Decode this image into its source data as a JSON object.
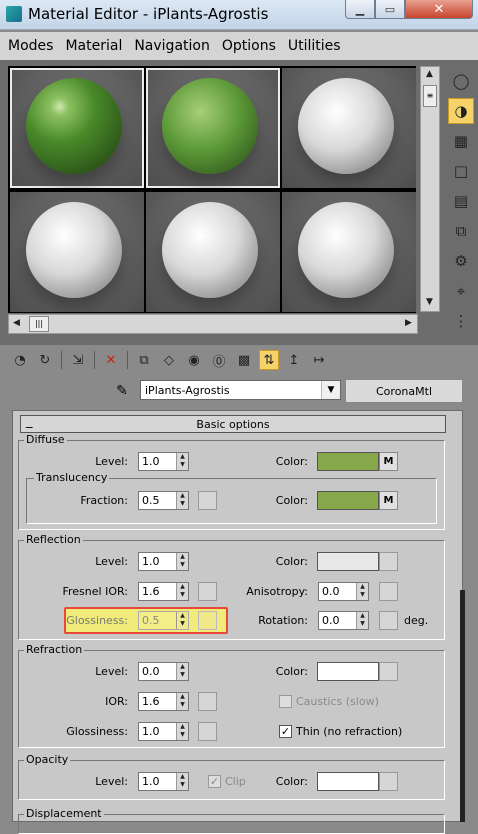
{
  "window": {
    "title": "Material Editor - iPlants-Agrostis",
    "app_icon": "3dsmax-icon"
  },
  "menu": [
    "Modes",
    "Material",
    "Navigation",
    "Options",
    "Utilities"
  ],
  "slots": [
    {
      "id": 1,
      "style": "glossy-green",
      "color": "#4a8a2a"
    },
    {
      "id": 2,
      "style": "matte-green",
      "color": "#5d9a38"
    },
    {
      "id": 3,
      "style": "white",
      "color": "#d8d8d8"
    },
    {
      "id": 4,
      "style": "white",
      "color": "#d8d8d8"
    },
    {
      "id": 5,
      "style": "white",
      "color": "#d8d8d8"
    },
    {
      "id": 6,
      "style": "white",
      "color": "#d8d8d8"
    }
  ],
  "material": {
    "name": "iPlants-Agrostis",
    "type": "CoronaMtl"
  },
  "rollout": {
    "title": "Basic options",
    "collapse": "_"
  },
  "diffuse": {
    "title": "Diffuse",
    "level_label": "Level:",
    "level": "1.0",
    "color_label": "Color:",
    "color": "#86a84a",
    "map": "M",
    "translucency": {
      "title": "Translucency",
      "fraction_label": "Fraction:",
      "fraction": "0.5",
      "color_label": "Color:",
      "color": "#86a84a",
      "map": "M"
    }
  },
  "reflection": {
    "title": "Reflection",
    "level_label": "Level:",
    "level": "1.0",
    "color_label": "Color:",
    "color": "#e8e8e8",
    "fresnel_label": "Fresnel IOR:",
    "fresnel": "1.6",
    "aniso_label": "Anisotropy:",
    "aniso": "0.0",
    "gloss_label": "Glossiness:",
    "gloss": "0.5",
    "rotation_label": "Rotation:",
    "rotation": "0.0",
    "deg": "deg."
  },
  "refraction": {
    "title": "Refraction",
    "level_label": "Level:",
    "level": "0.0",
    "color_label": "Color:",
    "color": "#ffffff",
    "ior_label": "IOR:",
    "ior": "1.6",
    "gloss_label": "Glossiness:",
    "gloss": "1.0",
    "caustics_label": "Caustics (slow)",
    "thin_label": "Thin (no refraction)",
    "thin_checked": "✓"
  },
  "opacity": {
    "title": "Opacity",
    "level_label": "Level:",
    "level": "1.0",
    "clip_label": "Clip",
    "clip_checked": "✓",
    "color_label": "Color:",
    "color": "#ffffff"
  },
  "displacement": {
    "title": "Displacement"
  },
  "highlight_color": "#e8483a"
}
